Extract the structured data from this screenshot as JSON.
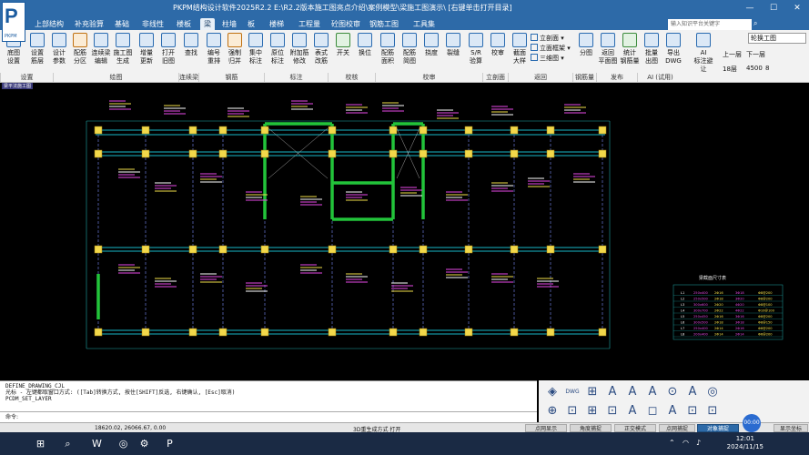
{
  "window": {
    "title": "PKPM结构设计软件2025R2.2 E:\\R2.2版本施工图亮点介绍\\案例模型\\梁施工图演示\\ [右键单击打开目录]",
    "logo_text": "P",
    "logo_sub": "PKPM",
    "controls": [
      "—",
      "☐",
      "✕"
    ]
  },
  "tabs": [
    "上部结构",
    "补充验算",
    "基础",
    "非线性",
    "楼板",
    "梁",
    "柱墙",
    "板",
    "楼梯",
    "工程量",
    "砼图校审",
    "钢筋工图",
    "工具集"
  ],
  "active_tab": "梁",
  "search_placeholder": "输入知识平台关键字",
  "ribbon": {
    "buttons": [
      {
        "label": "底图\n设置",
        "color": "b"
      },
      {
        "label": "设置\n筋层",
        "color": "b"
      },
      {
        "label": "设计\n参数",
        "color": "b"
      },
      {
        "label": "配筋\n分区",
        "color": "o"
      },
      {
        "label": "连续梁\n编辑",
        "color": "b"
      },
      {
        "label": "施工图\n生成",
        "color": "b"
      },
      {
        "label": "增量\n更新",
        "color": "b"
      },
      {
        "label": "打开\n旧图",
        "color": "b"
      },
      {
        "label": "查找",
        "color": "b"
      },
      {
        "label": "编号\n重排",
        "color": "b"
      },
      {
        "label": "强制\n归并",
        "color": "o"
      },
      {
        "label": "集中\n标注",
        "color": "b"
      },
      {
        "label": "原位\n标注",
        "color": "b"
      },
      {
        "label": "附加筋\n修改",
        "color": "b"
      },
      {
        "label": "表式\n改筋",
        "color": "b"
      },
      {
        "label": "开关",
        "color": "g"
      },
      {
        "label": "换位",
        "color": "b"
      },
      {
        "label": "配筋\n面积",
        "color": "b"
      },
      {
        "label": "配筋\n简图",
        "color": "b"
      },
      {
        "label": "挠度",
        "color": "b"
      },
      {
        "label": "裂缝",
        "color": "b"
      },
      {
        "label": "S/R\n验算",
        "color": "b"
      },
      {
        "label": "校审",
        "color": "b"
      },
      {
        "label": "截面\n大样",
        "color": "b"
      },
      {
        "label": "分图",
        "color": "b"
      },
      {
        "label": "返回\n平面图",
        "color": "b"
      },
      {
        "label": "统计\n钢筋量",
        "color": "g"
      },
      {
        "label": "批量\n出图",
        "color": "b"
      },
      {
        "label": "导出\nDWG",
        "color": "b"
      },
      {
        "label": "AI\n标注避让",
        "color": "b"
      }
    ],
    "small_buttons": [
      "立剖面 ▾",
      "立面框架 ▾",
      "三维图 ▾"
    ],
    "groups": [
      "设置",
      "绘图",
      "连续梁",
      "钢筋",
      "标注",
      "校核",
      "校审",
      "立剖面",
      "返回",
      "钢筋量",
      "发布",
      "AI (试用)"
    ],
    "floor_select": "轮换工图",
    "nav": {
      "up": "上一层",
      "down": "下一层"
    },
    "floor_info": {
      "floor": "18层",
      "height": "4500",
      "num": "8"
    }
  },
  "canvas": {
    "label": "梁平法施工图",
    "legend_title": "梁截面尺寸表",
    "legend_rows": [
      [
        "L1",
        "250x400",
        "2Φ16",
        "3Φ18",
        "Φ8@200"
      ],
      [
        "L2",
        "250x500",
        "2Φ18",
        "3Φ20",
        "Φ8@200"
      ],
      [
        "L3",
        "300x600",
        "2Φ20",
        "4Φ20",
        "Φ8@100"
      ],
      [
        "L4",
        "300x700",
        "2Φ22",
        "4Φ22",
        "Φ10@100"
      ],
      [
        "L5",
        "250x450",
        "2Φ16",
        "3Φ16",
        "Φ8@200"
      ],
      [
        "L6",
        "300x500",
        "2Φ18",
        "3Φ18",
        "Φ8@150"
      ],
      [
        "L7",
        "250x400",
        "2Φ14",
        "2Φ16",
        "Φ8@200"
      ],
      [
        "L8",
        "200x400",
        "2Φ14",
        "2Φ14",
        "Φ6@200"
      ]
    ]
  },
  "command": {
    "lines": [
      "DEFINE_DRAWING_CJL",
      "光标 - 左键都取窗口方式: ([Tab]转换方式, 按住[SHIFT]反选, 右键确认, [Esc]取消)",
      "PCDM_SET_LAYER"
    ],
    "prompt": "命令:"
  },
  "status": {
    "coords": "18620.02, 26066.67, 0.00",
    "msg": "3D重生成方式   打开",
    "buttons": [
      "点网显示",
      "角度捕捉",
      "正交模式",
      "点网捕捉",
      "对象捕捉",
      "显示坐标"
    ],
    "active": [
      "对象捕捉"
    ]
  },
  "fab_label": "00:00",
  "taskbar": {
    "time": "12:01",
    "date": "2024/11/15",
    "icons": [
      "⊞",
      "⌕",
      "W",
      "◎",
      "⚙",
      "P"
    ]
  },
  "tool_icons": [
    "◈",
    "DWG",
    "⊞",
    "A",
    "A",
    "A",
    "⊙",
    "A",
    "◎",
    "⊕",
    "⊡",
    "⊞",
    "⊡",
    "A",
    "◻",
    "A",
    "⊡",
    "⊡"
  ]
}
